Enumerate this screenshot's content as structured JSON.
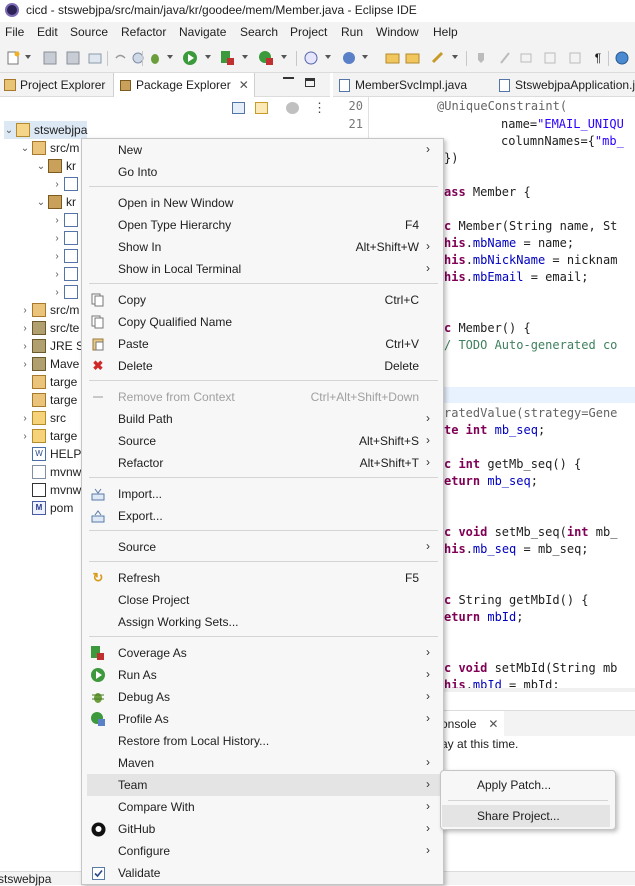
{
  "window": {
    "title": "cicd - stswebjpa/src/main/java/kr/goodee/mem/Member.java - Eclipse IDE"
  },
  "menubar": [
    "File",
    "Edit",
    "Source",
    "Refactor",
    "Navigate",
    "Search",
    "Project",
    "Run",
    "Window",
    "Help"
  ],
  "left_view": {
    "tabs": [
      "Project Explorer",
      "Package Explorer"
    ],
    "tree": {
      "project": "stswebjpa",
      "src_main": "src/m",
      "pkg1": "kr",
      "pkg2": "kr",
      "src_m2": "src/m",
      "src_te": "src/te",
      "jre": "JRE S",
      "maven": "Mave",
      "target1": "targe",
      "target2": "targe",
      "src": "src",
      "target3": "targe",
      "help": "HELP",
      "mvnw1": "mvnw",
      "mvnw2": "mvnw",
      "pom": "pom"
    }
  },
  "editor": {
    "tabs": [
      "MemberSvcImpl.java",
      "StswebjpaApplication.j"
    ],
    "line_numbers": [
      "20",
      "21"
    ],
    "code": {
      "l1": "@UniqueConstraint(",
      "l2_a": "name=",
      "l2_b": "\"EMAIL_UNIQU",
      "l3_a": "columnNames={",
      "l3_b": "\"mb_",
      "l4": "})",
      "l5_a": "ass",
      "l5_b": " Member {",
      "l6_a": "c",
      "l6_b": " Member(String name, St",
      "l7_a": "his",
      "l7_b": ".",
      "l7_c": "mbName",
      "l7_d": " = name;",
      "l8_a": "his",
      "l8_b": ".",
      "l8_c": "mbNickName",
      "l8_d": " = nicknam",
      "l9_a": "his",
      "l9_b": ".",
      "l9_c": "mbEmail",
      "l9_d": " = email;",
      "l10_a": "c",
      "l10_b": " Member() {",
      "l11": "/ TODO Auto-generated co",
      "l12": "ratedValue(strategy=Gene",
      "l13_a": "te int",
      "l13_b": " ",
      "l13_c": "mb_seq",
      "l13_d": ";",
      "l14_a": "c int",
      "l14_b": " getMb_seq() {",
      "l15_a": "eturn",
      "l15_b": " ",
      "l15_c": "mb_seq",
      "l15_d": ";",
      "l16_a": "c void",
      "l16_b": " setMb_seq(",
      "l16_c": "int",
      "l16_d": " mb_",
      "l17_a": "his",
      "l17_b": ".",
      "l17_c": "mb_seq",
      "l17_d": " = mb_seq;",
      "l18_a": "c",
      "l18_b": " String getMbId() {",
      "l19_a": "eturn",
      "l19_b": " ",
      "l19_c": "mbId",
      "l19_d": ";",
      "l20_a": "c void",
      "l20_b": " setMbId(String mb",
      "l21_a": "his",
      "l21_b": ".",
      "l21_c": "mbId",
      "l21_d": " = mbId;"
    }
  },
  "console": {
    "tab": "onsole",
    "message": "ay at this time."
  },
  "status_bar": {
    "text": "stswebjpa"
  },
  "context_menu": {
    "items": [
      {
        "label": "New",
        "shortcut": "",
        "submenu": true
      },
      {
        "label": "Go Into",
        "shortcut": "",
        "submenu": false
      },
      {
        "label": "Open in New Window",
        "shortcut": "",
        "submenu": false
      },
      {
        "label": "Open Type Hierarchy",
        "shortcut": "F4",
        "submenu": false
      },
      {
        "label": "Show In",
        "shortcut": "Alt+Shift+W",
        "submenu": true
      },
      {
        "label": "Show in Local Terminal",
        "shortcut": "",
        "submenu": true
      },
      {
        "label": "Copy",
        "shortcut": "Ctrl+C",
        "submenu": false
      },
      {
        "label": "Copy Qualified Name",
        "shortcut": "",
        "submenu": false
      },
      {
        "label": "Paste",
        "shortcut": "Ctrl+V",
        "submenu": false
      },
      {
        "label": "Delete",
        "shortcut": "Delete",
        "submenu": false
      },
      {
        "label": "Remove from Context",
        "shortcut": "Ctrl+Alt+Shift+Down",
        "submenu": false,
        "disabled": true
      },
      {
        "label": "Build Path",
        "shortcut": "",
        "submenu": true
      },
      {
        "label": "Source",
        "shortcut": "Alt+Shift+S",
        "submenu": true
      },
      {
        "label": "Refactor",
        "shortcut": "Alt+Shift+T",
        "submenu": true
      },
      {
        "label": "Import...",
        "shortcut": "",
        "submenu": false
      },
      {
        "label": "Export...",
        "shortcut": "",
        "submenu": false
      },
      {
        "label": "Source",
        "shortcut": "",
        "submenu": true
      },
      {
        "label": "Refresh",
        "shortcut": "F5",
        "submenu": false
      },
      {
        "label": "Close Project",
        "shortcut": "",
        "submenu": false
      },
      {
        "label": "Assign Working Sets...",
        "shortcut": "",
        "submenu": false
      },
      {
        "label": "Coverage As",
        "shortcut": "",
        "submenu": true
      },
      {
        "label": "Run As",
        "shortcut": "",
        "submenu": true
      },
      {
        "label": "Debug As",
        "shortcut": "",
        "submenu": true
      },
      {
        "label": "Profile As",
        "shortcut": "",
        "submenu": true
      },
      {
        "label": "Restore from Local History...",
        "shortcut": "",
        "submenu": false
      },
      {
        "label": "Maven",
        "shortcut": "",
        "submenu": true
      },
      {
        "label": "Team",
        "shortcut": "",
        "submenu": true,
        "highlighted": true
      },
      {
        "label": "Compare With",
        "shortcut": "",
        "submenu": true
      },
      {
        "label": "GitHub",
        "shortcut": "",
        "submenu": true
      },
      {
        "label": "Configure",
        "shortcut": "",
        "submenu": true
      },
      {
        "label": "Validate",
        "shortcut": "",
        "submenu": false
      }
    ]
  },
  "team_submenu": {
    "items": [
      {
        "label": "Apply Patch..."
      },
      {
        "label": "Share Project...",
        "highlighted": true
      }
    ]
  },
  "colors": {
    "menu_bg": "#f7f7f7",
    "hover_bg": "#e4e4e4",
    "keyword": "#7f0055",
    "string": "#2a00ff",
    "field": "#0000c0",
    "comment": "#3f7f5f"
  }
}
